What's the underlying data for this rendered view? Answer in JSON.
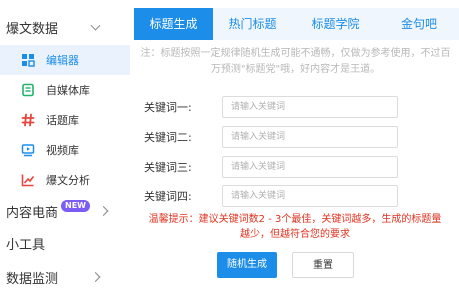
{
  "sidebar": {
    "group_viral": "爆文数据",
    "items": [
      {
        "label": "编辑器",
        "icon": "grid-icon",
        "color": "#1c8de8"
      },
      {
        "label": "自媒体库",
        "icon": "book-icon",
        "color": "#1fb36a"
      },
      {
        "label": "话题库",
        "icon": "hash-icon",
        "color": "#e8453c"
      },
      {
        "label": "视频库",
        "icon": "video-icon",
        "color": "#1c8de8"
      },
      {
        "label": "爆文分析",
        "icon": "chart-icon",
        "color": "#e8453c"
      }
    ],
    "group_ecommerce": "内容电商",
    "new_badge": "NEW",
    "group_tools": "小工具",
    "group_monitor": "数据监测"
  },
  "tabs": [
    "标题生成",
    "热门标题",
    "标题学院",
    "金句吧"
  ],
  "notice": "注：标题按照一定规律随机生成可能不通畅，仅做为参考使用，不过百万预测\"标题党\"哦，好内容才是王道。",
  "form": {
    "fields": [
      {
        "label": "关键词一:",
        "placeholder": "请输入关键词"
      },
      {
        "label": "关键词二:",
        "placeholder": "请输入关键词"
      },
      {
        "label": "关键词三:",
        "placeholder": "请输入关键词"
      },
      {
        "label": "关键词四:",
        "placeholder": "请输入关键词"
      }
    ],
    "tip": "温馨提示：建议关键词数2 - 3个最佳，关键词越多，生成的标题量越少，但越符合您的要求",
    "generate_label": "随机生成",
    "reset_label": "重置"
  },
  "colors": {
    "accent": "#1c8de8",
    "warning": "#e0321f",
    "badge": "#7b5cf5"
  }
}
